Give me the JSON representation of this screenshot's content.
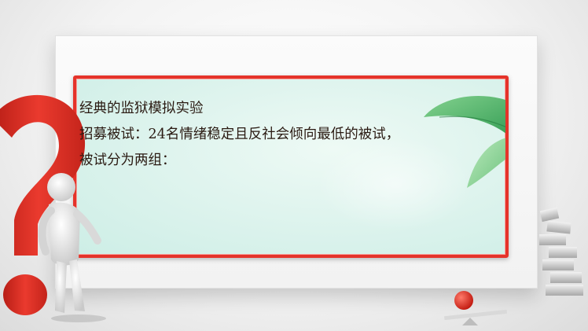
{
  "slide": {
    "title": "经典的监狱模拟实验",
    "line1": "招募被试：24名情绪稳定且反社会倾向最低的被试，",
    "line2": "被试分为两组："
  },
  "colors": {
    "frame_red": "#e5332a",
    "panel_teal": "#dff4ee",
    "leaf_green": "#3aa85a",
    "text": "#2a1a12"
  },
  "icons": {
    "question_mark": "red-question-mark",
    "figure": "white-3d-figure",
    "blocks": "stacked-grey-blocks",
    "seesaw": "red-ball-seesaw",
    "leaf": "green-leaf"
  }
}
